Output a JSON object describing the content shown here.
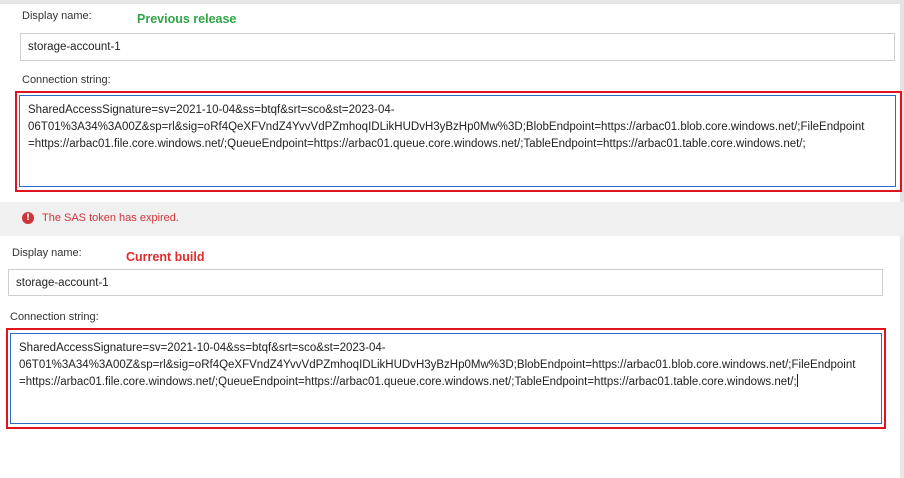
{
  "previous": {
    "tag": "Previous release",
    "display_name_label": "Display name:",
    "display_name_value": "storage-account-1",
    "connection_label": "Connection string:",
    "connection_lines": [
      "SharedAccessSignature=sv=2021-10-04&ss=btqf&srt=sco&st=2023-04-",
      "06T01%3A34%3A00Z&sp=rl&sig=oRf4QeXFVndZ4YvvVdPZmhoqIDLikHUDvH3yBzHp0Mw%3D;BlobEndpoint=https://arbac01.blob.core.windows.net/;FileEndpoint",
      "=https://arbac01.file.core.windows.net/;QueueEndpoint=https://arbac01.queue.core.windows.net/;TableEndpoint=https://arbac01.table.core.windows.net/;"
    ],
    "error_icon": "error-circle-icon",
    "error_text": "The SAS token has expired."
  },
  "current": {
    "tag": "Current build",
    "display_name_label": "Display name:",
    "display_name_value": "storage-account-1",
    "connection_label": "Connection string:",
    "connection_lines": [
      "SharedAccessSignature=sv=2021-10-04&ss=btqf&srt=sco&st=2023-04-",
      "06T01%3A34%3A00Z&sp=rl&sig=oRf4QeXFVndZ4YvvVdPZmhoqIDLikHUDvH3yBzHp0Mw%3D;BlobEndpoint=https://arbac01.blob.core.windows.net/;FileEndpoint",
      "=https://arbac01.file.core.windows.net/;QueueEndpoint=https://arbac01.queue.core.windows.net/;TableEndpoint=https://arbac01.table.core.windows.net/;"
    ]
  },
  "colors": {
    "highlight": "#e0141e",
    "previous_tag": "#30a548",
    "current_tag": "#e02b2b",
    "error": "#d13438",
    "focus_border": "#2a6bc4"
  }
}
